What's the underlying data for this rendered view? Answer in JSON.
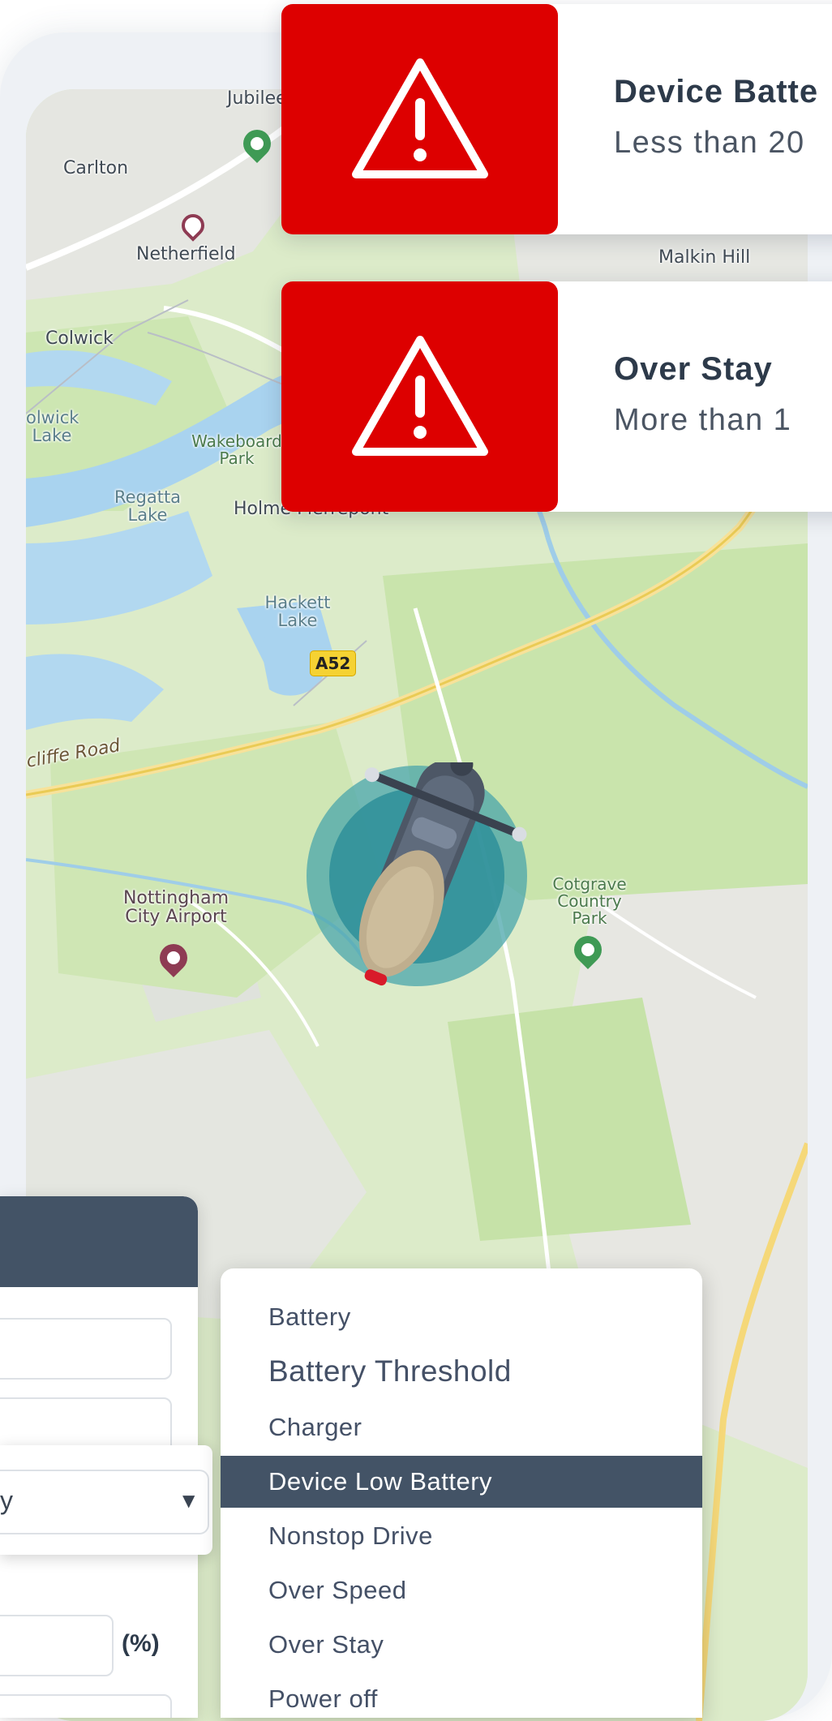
{
  "alerts": [
    {
      "title": "Device Batte",
      "message": "Less than 20",
      "icon": "warning-triangle-icon",
      "color": "#dd0000"
    },
    {
      "title": "Over Stay",
      "message": "More than 1",
      "icon": "warning-triangle-icon",
      "color": "#dd0000"
    }
  ],
  "map": {
    "places": [
      "Jubilee Park",
      "Carlton",
      "Netherfield",
      "Colwick",
      "olwick Lake",
      "Wakeboard Park",
      "Regatta Lake",
      "Holme Pierrepont",
      "Hackett Lake",
      "Malkin Hill",
      "Nottingham City Airport",
      "Cotgrave Country Park"
    ],
    "road_label": "cliffe Road",
    "road_badge": "A52",
    "marker": "scooter-icon"
  },
  "form": {
    "select_value": "y",
    "unit": "(%)"
  },
  "dropdown": {
    "options": [
      "Battery",
      "Battery Threshold",
      "Charger",
      "Device Low Battery",
      "Nonstop Drive",
      "Over Speed",
      "Over Stay",
      "Power off"
    ],
    "selected": "Device Low Battery",
    "selected_color": "#435366"
  }
}
